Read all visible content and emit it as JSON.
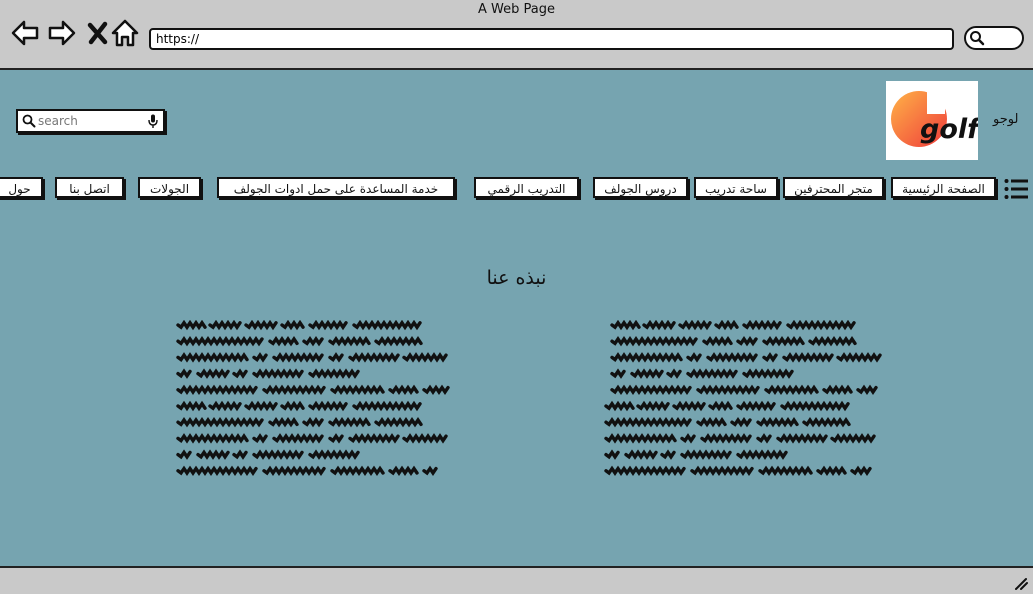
{
  "browser": {
    "window_title": "A Web Page",
    "address": "https://"
  },
  "header": {
    "search_placeholder": "search",
    "logo_alt_text": "لوجو",
    "logo_word": "golf",
    "logo_colors": {
      "start": "#ffb347",
      "end": "#ef3b3b"
    }
  },
  "nav": {
    "items": [
      {
        "label": "الصفحة الرئيسية"
      },
      {
        "label": "متجر المحترفين"
      },
      {
        "label": "ساحة تدريب"
      },
      {
        "label": "دروس الجولف"
      },
      {
        "label": "التدريب الرقمي"
      },
      {
        "label": "خدمة المساعدة على حمل ادوات الجولف"
      },
      {
        "label": "الجولات"
      },
      {
        "label": "اتصل بنا"
      },
      {
        "label": "حول"
      }
    ]
  },
  "about": {
    "title": "نبذه عنا"
  },
  "colors": {
    "page_bg": "#76a4b0",
    "chrome_bg": "#c9c9c9"
  }
}
